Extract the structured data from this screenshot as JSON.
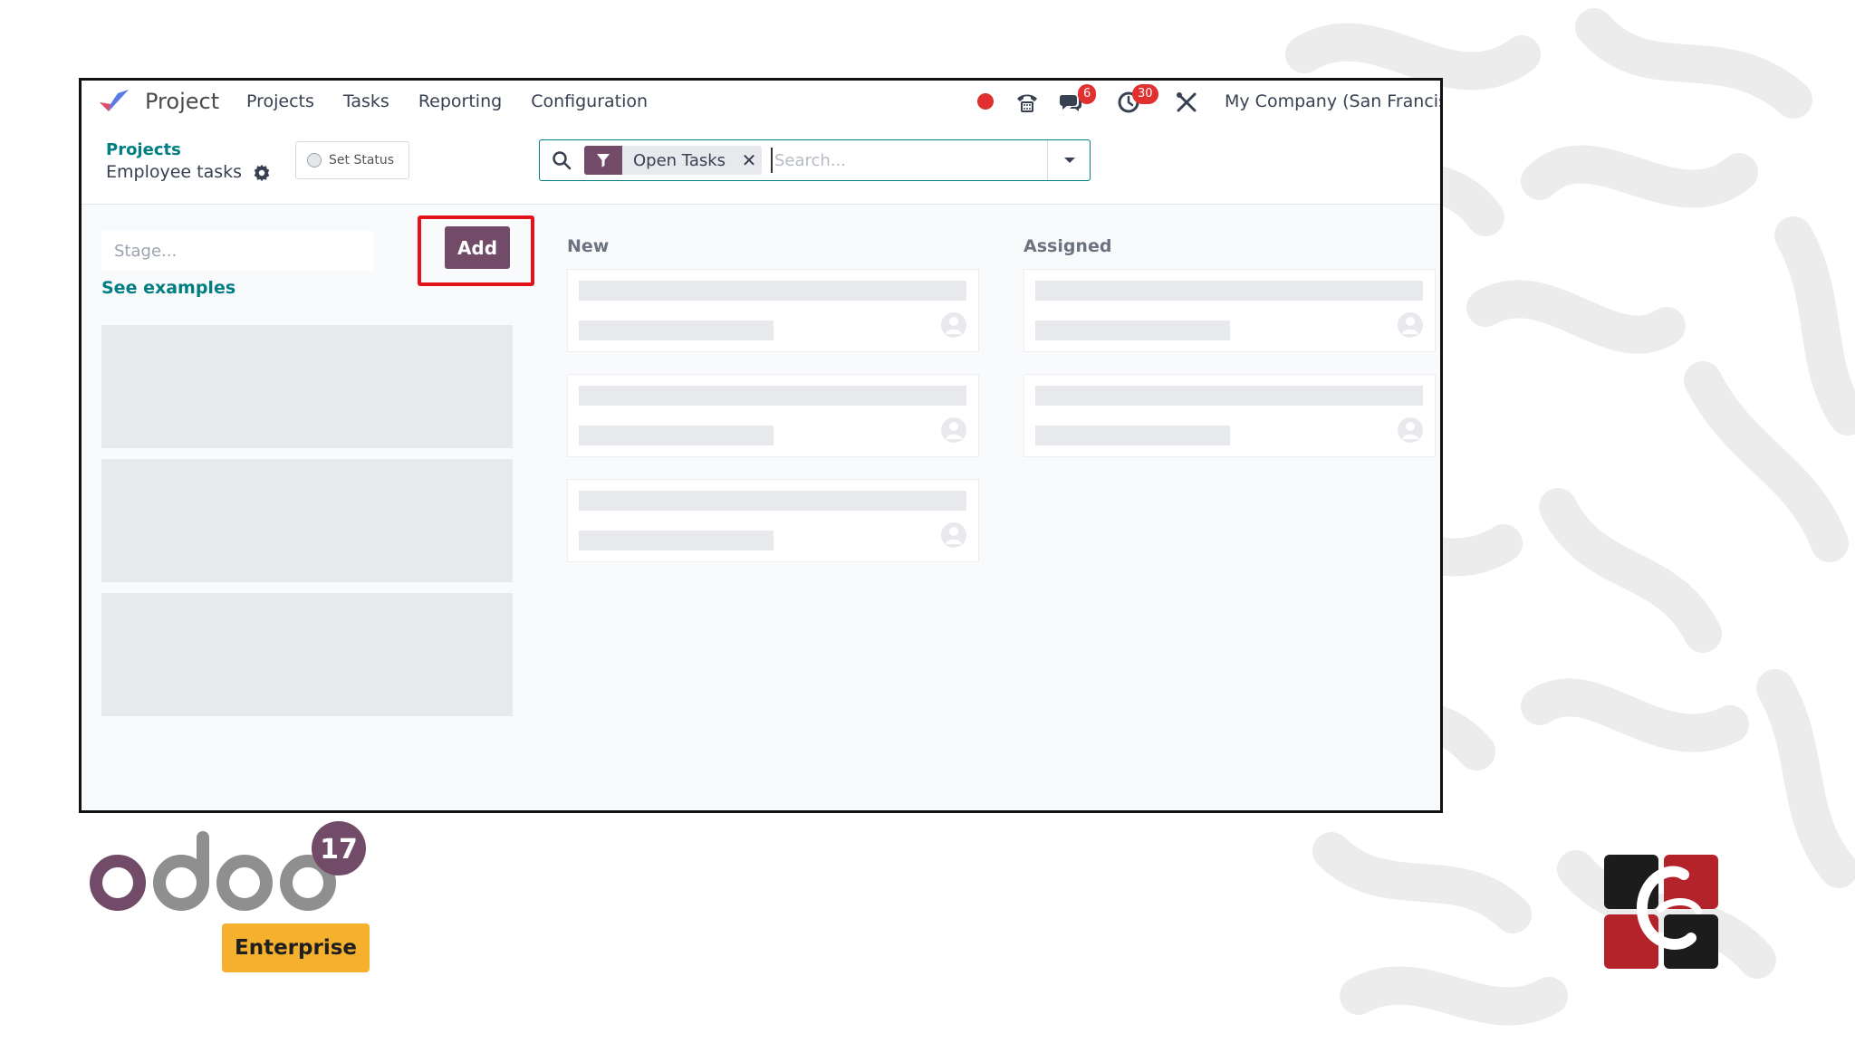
{
  "navbar": {
    "app_name": "Project",
    "menu": [
      "Projects",
      "Tasks",
      "Reporting",
      "Configuration"
    ],
    "messages_badge": "6",
    "activities_badge": "30",
    "company": "My Company (San Francis"
  },
  "control_panel": {
    "breadcrumb_parent": "Projects",
    "breadcrumb_current": "Employee tasks",
    "set_status_label": "Set Status",
    "search": {
      "facet_label": "Open Tasks",
      "placeholder": "Search..."
    }
  },
  "kanban": {
    "stage_placeholder": "Stage...",
    "add_label": "Add",
    "see_examples": "See examples",
    "columns": [
      {
        "title": "New",
        "cards": 3
      },
      {
        "title": "Assigned",
        "cards": 2
      }
    ]
  },
  "branding": {
    "version": "17",
    "edition": "Enterprise"
  },
  "colors": {
    "brand_purple": "#714b67",
    "teal": "#017e84",
    "highlight_red": "#e3131b",
    "enterprise_yellow": "#f5b02e"
  }
}
